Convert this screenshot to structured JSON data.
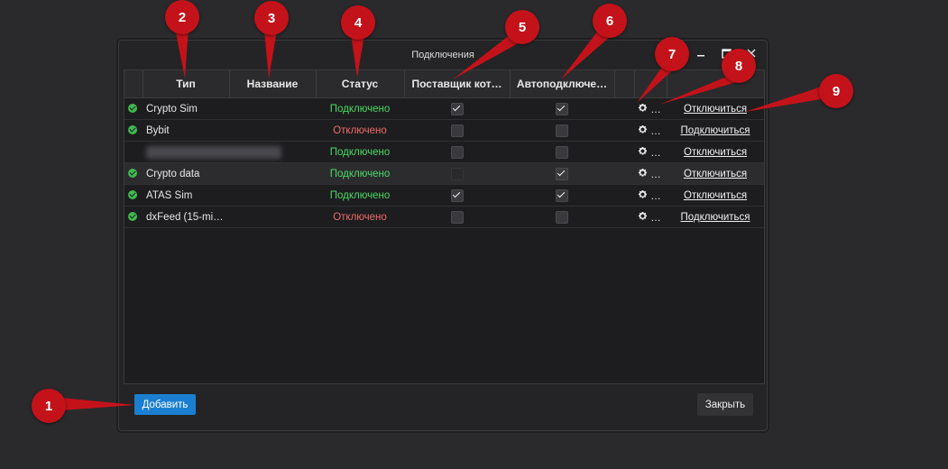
{
  "window": {
    "title": "Подключения"
  },
  "columns": [
    "Тип",
    "Название",
    "Статус",
    "Поставщик кот…",
    "Автоподключе…"
  ],
  "rows": [
    {
      "type": "Crypto Sim",
      "name": "",
      "status": "Подключено",
      "status_kind": "on",
      "provider": true,
      "autoconnect": true,
      "action": "Отключиться",
      "selected": false,
      "blurred": false
    },
    {
      "type": "Bybit",
      "name": "",
      "status": "Отключено",
      "status_kind": "off",
      "provider": false,
      "autoconnect": false,
      "action": "Подключиться",
      "selected": false,
      "blurred": false
    },
    {
      "type": "",
      "name": "",
      "status": "Подключено",
      "status_kind": "on",
      "provider": false,
      "autoconnect": false,
      "action": "Отключиться",
      "selected": false,
      "blurred": true
    },
    {
      "type": "Crypto data",
      "name": "",
      "status": "Подключено",
      "status_kind": "on",
      "provider": false,
      "autoconnect": true,
      "action": "Отключиться",
      "selected": true,
      "blurred": false
    },
    {
      "type": "ATAS Sim",
      "name": "",
      "status": "Подключено",
      "status_kind": "on",
      "provider": true,
      "autoconnect": true,
      "action": "Отключиться",
      "selected": false,
      "blurred": false
    },
    {
      "type": "dxFeed (15-mi…",
      "name": "",
      "status": "Отключено",
      "status_kind": "off",
      "provider": false,
      "autoconnect": false,
      "action": "Подключиться",
      "selected": false,
      "blurred": false
    }
  ],
  "buttons": {
    "add": "Добавить",
    "close": "Закрыть"
  },
  "markers": [
    "1",
    "2",
    "3",
    "4",
    "5",
    "6",
    "7",
    "8",
    "9"
  ],
  "colors": {
    "accent": "#1b7fd1",
    "connected": "#4cd964",
    "disconnected": "#ee6a6a",
    "marker": "#c4121a"
  }
}
